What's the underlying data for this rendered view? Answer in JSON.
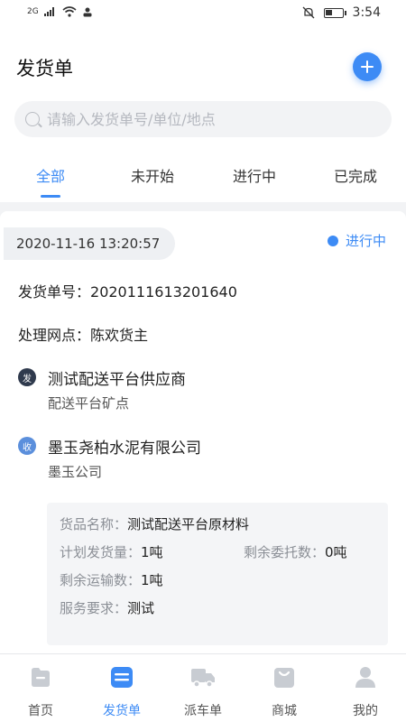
{
  "statusbar": {
    "signal": "2G",
    "time": "3:54"
  },
  "header": {
    "title": "发货单",
    "search_placeholder": "请输入发货单号/单位/地点"
  },
  "tabs": [
    {
      "label": "全部",
      "active": true
    },
    {
      "label": "未开始",
      "active": false
    },
    {
      "label": "进行中",
      "active": false
    },
    {
      "label": "已完成",
      "active": false
    }
  ],
  "order": {
    "datetime": "2020-11-16 13:20:57",
    "status": "进行中",
    "number_label": "发货单号：",
    "number": "2020111613201640",
    "point_label": "处理网点：",
    "point": "陈欢货主",
    "sender": {
      "icon_char": "发",
      "name": "测试配送平台供应商",
      "sub": "配送平台矿点"
    },
    "receiver": {
      "icon_char": "收",
      "name": "墨玉尧柏水泥有限公司",
      "sub": "墨玉公司"
    },
    "goods": {
      "name_label": "货品名称：",
      "name": "测试配送平台原材料",
      "plan_label": "计划发货量：",
      "plan": "1吨",
      "remain_entrust_label": "剩余委托数：",
      "remain_entrust": "0吨",
      "remain_transport_label": "剩余运输数：",
      "remain_transport": "1吨",
      "service_label": "服务要求：",
      "service": "测试"
    }
  },
  "tabbar": [
    {
      "label": "首页",
      "icon": "home-icon",
      "active": false
    },
    {
      "label": "发货单",
      "icon": "invoice-icon",
      "active": true
    },
    {
      "label": "派车单",
      "icon": "truck-icon",
      "active": false
    },
    {
      "label": "商城",
      "icon": "shop-bag-icon",
      "active": false
    },
    {
      "label": "我的",
      "icon": "user-icon",
      "active": false
    }
  ],
  "colors": {
    "accent": "#3d8bf5",
    "sender_icon": "#2f3a4d",
    "receiver_icon": "#5b8fdc",
    "inactive_icon": "#c8ccd2"
  }
}
